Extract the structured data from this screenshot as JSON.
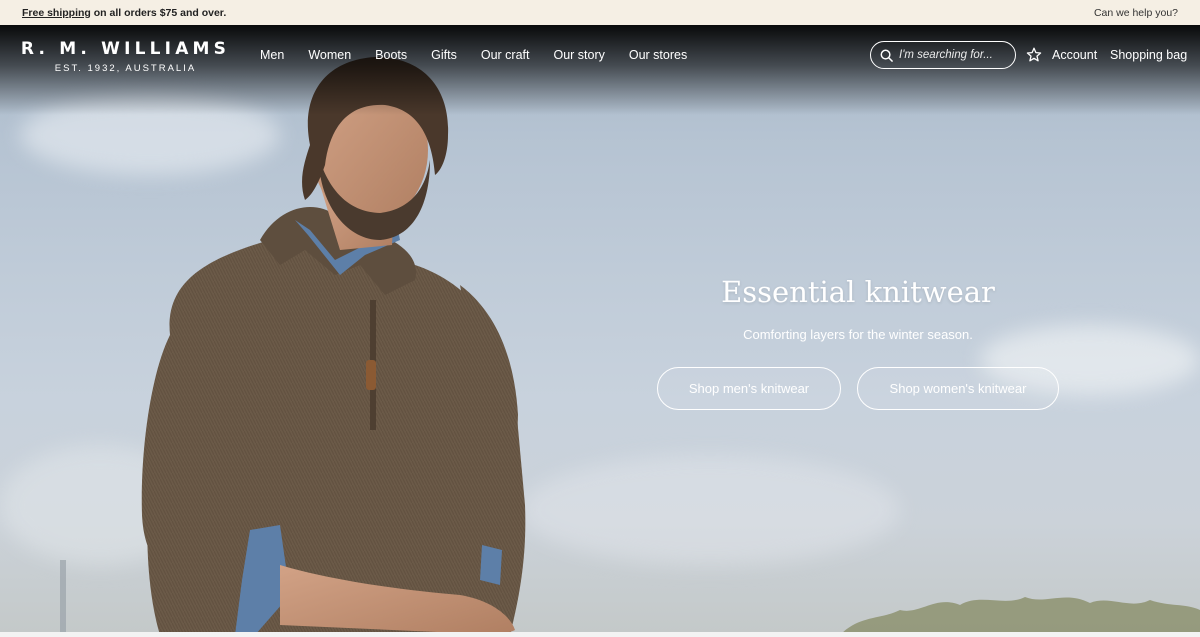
{
  "promo": {
    "link_text": "Free shipping",
    "rest_text": " on all orders $75 and over.",
    "help": "Can we help you?"
  },
  "logo": {
    "brand": "R. M. WILLIAMS",
    "tagline": "EST. 1932, AUSTRALIA"
  },
  "nav": {
    "items": [
      "Men",
      "Women",
      "Boots",
      "Gifts",
      "Our craft",
      "Our story",
      "Our stores"
    ]
  },
  "header": {
    "search_placeholder": "I'm searching for...",
    "wishlist_icon": "star-icon",
    "account": "Account",
    "bag": "Shopping bag"
  },
  "hero": {
    "headline": "Essential knitwear",
    "subline": "Comforting layers for the winter season.",
    "cta_men": "Shop men's knitwear",
    "cta_women": "Shop women's knitwear"
  },
  "colors": {
    "promo_bg": "#f5efe4",
    "sweater": "#6b5a48",
    "shirt": "#5d7fa8"
  }
}
